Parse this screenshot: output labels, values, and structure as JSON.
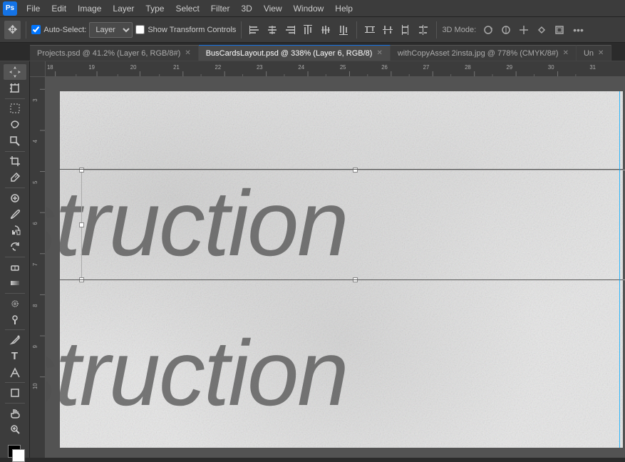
{
  "app": {
    "logo": "Ps",
    "logo_bg": "#1473e6"
  },
  "menubar": {
    "items": [
      "File",
      "Edit",
      "Image",
      "Layer",
      "Type",
      "Select",
      "Filter",
      "3D",
      "View",
      "Window",
      "Help"
    ]
  },
  "toolbar": {
    "move_icon": "✥",
    "auto_select_label": "Auto-Select:",
    "layer_option": "Layer",
    "show_transform_label": "Show Transform Controls",
    "align_icons": [
      "≡",
      "≡",
      "≡",
      "≡",
      "≡",
      "≡"
    ],
    "spacing_icons": [
      "⊟",
      "⊟",
      "⊟",
      "⊟"
    ],
    "mode_label": "3D Mode:",
    "more_icon": "•••"
  },
  "tabs": [
    {
      "label": "Projects.psd @ 41.2% (Layer 6, RGB/8#)",
      "active": false
    },
    {
      "label": "BusCardsLayout.psd @ 338% (Layer 6, RGB/8)",
      "active": true
    },
    {
      "label": "withCopyAsset 2insta.jpg @ 778% (CMYK/8#)",
      "active": false
    },
    {
      "label": "Un",
      "active": false
    }
  ],
  "canvas": {
    "text1": "nstruction",
    "text2": "nstruction",
    "zoom": "338%",
    "color_mode": "RGB/8"
  },
  "rulers": {
    "h_marks": [
      "18",
      "19",
      "20",
      "21",
      "22",
      "23",
      "24",
      "25",
      "26",
      "27",
      "28",
      "29",
      "30",
      "31"
    ],
    "v_marks": [
      "3",
      "4",
      "5",
      "6",
      "7",
      "8",
      "9",
      "10"
    ]
  },
  "lefttools": [
    {
      "icon": "✥",
      "name": "move"
    },
    {
      "icon": "⬚",
      "name": "artboard"
    },
    {
      "icon": "⬜",
      "name": "marquee"
    },
    {
      "icon": "∿",
      "name": "lasso"
    },
    {
      "icon": "⚡",
      "name": "magic-wand"
    },
    {
      "icon": "✂",
      "name": "crop"
    },
    {
      "icon": "⊕",
      "name": "eyedropper"
    },
    {
      "icon": "⌗",
      "name": "healing"
    },
    {
      "icon": "🖌",
      "name": "brush"
    },
    {
      "icon": "⌂",
      "name": "stamp"
    },
    {
      "icon": "◐",
      "name": "history"
    },
    {
      "icon": "◻",
      "name": "eraser"
    },
    {
      "icon": "▓",
      "name": "gradient"
    },
    {
      "icon": "🔍",
      "name": "blur"
    },
    {
      "icon": "◎",
      "name": "dodge"
    },
    {
      "icon": "✏",
      "name": "pen"
    },
    {
      "icon": "T",
      "name": "type"
    },
    {
      "icon": "↗",
      "name": "path-select"
    },
    {
      "icon": "◻",
      "name": "shape"
    },
    {
      "icon": "✋",
      "name": "hand"
    },
    {
      "icon": "🔍",
      "name": "zoom"
    }
  ]
}
